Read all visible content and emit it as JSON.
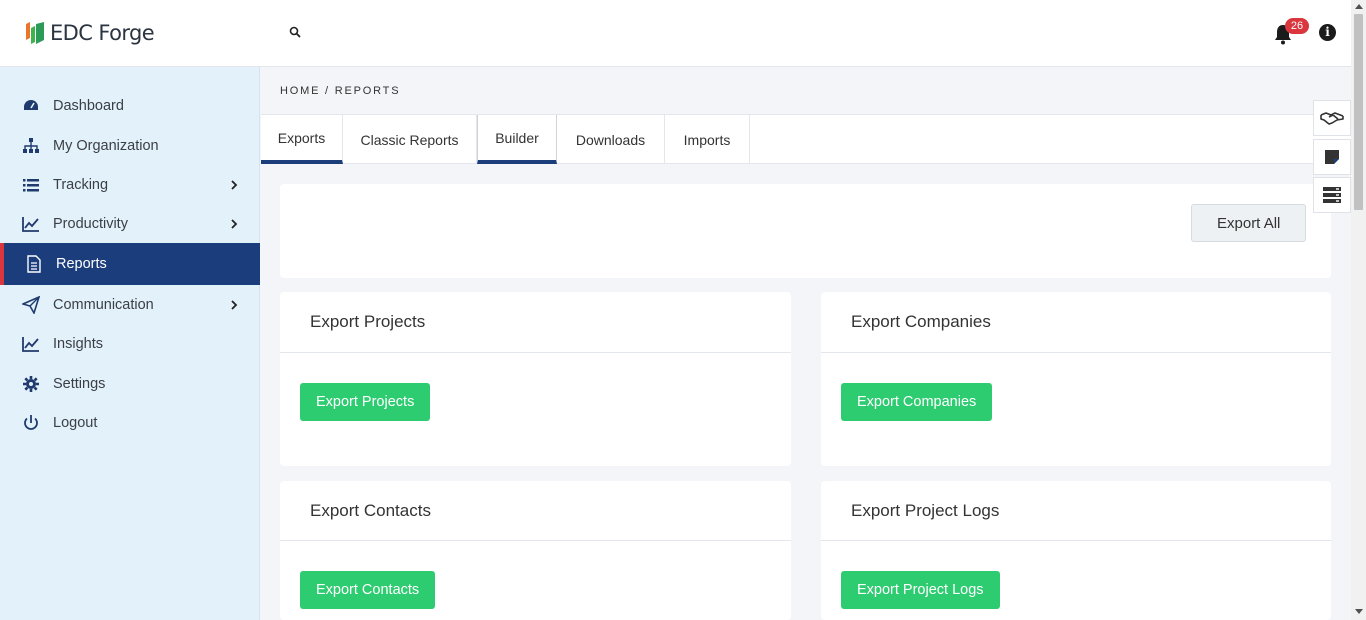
{
  "app": {
    "logo_text": "EDC Forge"
  },
  "header": {
    "notification_count": "26"
  },
  "sidebar": {
    "items": [
      {
        "label": "Dashboard",
        "icon": "gauge-icon"
      },
      {
        "label": "My Organization",
        "icon": "sitemap-icon"
      },
      {
        "label": "Tracking",
        "icon": "list-icon",
        "has_submenu": true
      },
      {
        "label": "Productivity",
        "icon": "chart-line-icon",
        "has_submenu": true
      },
      {
        "label": "Reports",
        "icon": "file-text-icon",
        "active": true
      },
      {
        "label": "Communication",
        "icon": "paper-plane-icon",
        "has_submenu": true
      },
      {
        "label": "Insights",
        "icon": "chart-line-icon"
      },
      {
        "label": "Settings",
        "icon": "gear-icon"
      },
      {
        "label": "Logout",
        "icon": "power-icon"
      }
    ]
  },
  "breadcrumb": "HOME / REPORTS",
  "tabs": [
    {
      "label": "Exports",
      "active": true
    },
    {
      "label": "Classic Reports"
    },
    {
      "label": "Builder"
    },
    {
      "label": "Downloads"
    },
    {
      "label": "Imports"
    }
  ],
  "toolbar": {
    "export_all_label": "Export All"
  },
  "cards": [
    {
      "title": "Export Projects",
      "button": "Export Projects"
    },
    {
      "title": "Export Companies",
      "button": "Export Companies"
    },
    {
      "title": "Export Contacts",
      "button": "Export Contacts"
    },
    {
      "title": "Export Project Logs",
      "button": "Export Project Logs"
    }
  ],
  "floating_buttons": [
    "handshake-icon",
    "sticky-note-icon",
    "server-icon"
  ],
  "colors": {
    "primary": "#1c3d7c",
    "success": "#2ecc71",
    "danger": "#d9363e",
    "sidebar_bg": "#e3f1fb"
  }
}
